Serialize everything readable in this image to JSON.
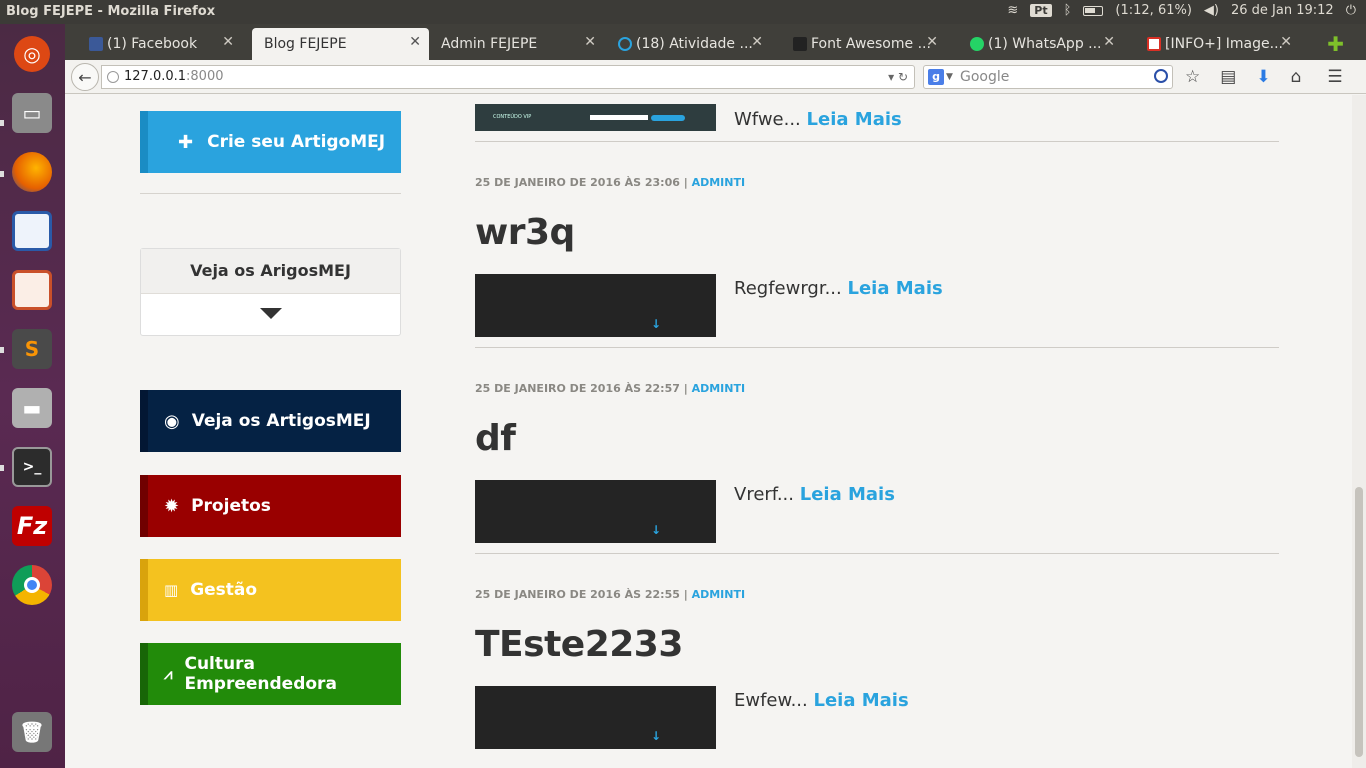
{
  "system_panel": {
    "window_title": "Blog FEJEPE - Mozilla Firefox",
    "keyboard": "Pt",
    "battery": "(1:12, 61%)",
    "datetime": "26 de Jan 19:12"
  },
  "launcher": {
    "items": [
      {
        "name": "ubuntu-dash",
        "color": "#dd4814"
      },
      {
        "name": "file-manager",
        "color": "#8a8a8a"
      },
      {
        "name": "firefox",
        "color": "#e66000"
      },
      {
        "name": "writer",
        "color": "#2a5aa8"
      },
      {
        "name": "impress",
        "color": "#c9502a"
      },
      {
        "name": "sublime-text",
        "color": "#4a4a4a"
      },
      {
        "name": "disk",
        "color": "#9a9a9a"
      },
      {
        "name": "terminal",
        "color": "#2c2c2c"
      },
      {
        "name": "filezilla",
        "color": "#bf0000"
      },
      {
        "name": "chrome",
        "color": "#2f8f3f"
      },
      {
        "name": "trash",
        "color": "#777777"
      }
    ]
  },
  "tabs": [
    {
      "label": "(1) Facebook",
      "icon": "facebook-icon",
      "icon_color": "#3b5998"
    },
    {
      "label": "Blog FEJEPE",
      "icon": "",
      "icon_color": ""
    },
    {
      "label": "Admin FEJEPE",
      "icon": "",
      "icon_color": ""
    },
    {
      "label": "(18) Atividade ...",
      "icon": "location-icon",
      "icon_color": "#2aa3de"
    },
    {
      "label": "Font Awesome ...",
      "icon": "flag-icon",
      "icon_color": "#222222"
    },
    {
      "label": "(1) WhatsApp ...",
      "icon": "whatsapp-icon",
      "icon_color": "#25d366"
    },
    {
      "label": "[INFO+] Image...",
      "icon": "gmail-icon",
      "icon_color": "#d93025"
    }
  ],
  "navbar": {
    "url_host": "127.0.0.1",
    "url_port": ":8000",
    "search_placeholder": "Google"
  },
  "sidebar": {
    "create_button": "Crie seu ArtigoMEJ",
    "dropdown_title": "Veja os ArigosMEJ",
    "buttons": [
      {
        "label": "Veja os ArtigosMEJ",
        "bg": "#052244",
        "edge": "#031733",
        "icon": "eye-icon"
      },
      {
        "label": "Projetos",
        "bg": "#990000",
        "edge": "#700000",
        "icon": "gear-icon"
      },
      {
        "label": "Gestão",
        "bg": "#f4c21f",
        "edge": "#d9a30c",
        "icon": "bar-chart-icon"
      },
      {
        "label": "Cultura Empreendedora",
        "bg": "#228b0a",
        "edge": "#186607",
        "icon": "line-chart-icon"
      }
    ]
  },
  "posts": [
    {
      "excerpt": "Wfwe...",
      "more": "Leia Mais",
      "thumb_text": "CONTEÚDO VIP"
    },
    {
      "meta": "25 DE JANEIRO DE 2016 ÀS 23:06 |",
      "author": "ADMINTI",
      "title": "wr3q",
      "excerpt": "Regfewrgr...",
      "more": "Leia Mais"
    },
    {
      "meta": "25 DE JANEIRO DE 2016 ÀS 22:57 |",
      "author": "ADMINTI",
      "title": "df",
      "excerpt": "Vrerf...",
      "more": "Leia Mais"
    },
    {
      "meta": "25 DE JANEIRO DE 2016 ÀS 22:55 |",
      "author": "ADMINTI",
      "title": "TEste2233",
      "excerpt": "Ewfew...",
      "more": "Leia Mais"
    }
  ]
}
